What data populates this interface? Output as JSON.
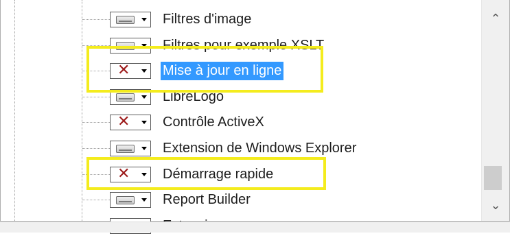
{
  "tree": {
    "items": [
      {
        "label": "Filtres d'image",
        "state": "installed",
        "icon": "drive-icon",
        "selected": false
      },
      {
        "label": "Filtres pour exemple XSLT",
        "state": "installed",
        "icon": "drive-icon",
        "selected": false
      },
      {
        "label": "Mise à jour en ligne",
        "state": "not-installed",
        "icon": "x-icon",
        "selected": true
      },
      {
        "label": "LibreLogo",
        "state": "installed",
        "icon": "drive-icon",
        "selected": false
      },
      {
        "label": "Contrôle ActiveX",
        "state": "not-installed",
        "icon": "x-icon",
        "selected": false
      },
      {
        "label": "Extension de Windows Explorer",
        "state": "installed",
        "icon": "drive-icon",
        "selected": false
      },
      {
        "label": "Démarrage rapide",
        "state": "not-installed",
        "icon": "x-icon",
        "selected": false
      },
      {
        "label": "Report Builder",
        "state": "installed",
        "icon": "drive-icon",
        "selected": false
      },
      {
        "label": "Extensions",
        "state": "installed",
        "icon": "drive-icon",
        "selected": false
      }
    ],
    "x_glyph": "✕"
  },
  "scrollbar": {
    "up_glyph": "⌃",
    "down_glyph": "⌄"
  },
  "colors": {
    "selection": "#3399ff",
    "highlight_box": "#f4ec1d",
    "x_mark": "#9d1b1b"
  }
}
